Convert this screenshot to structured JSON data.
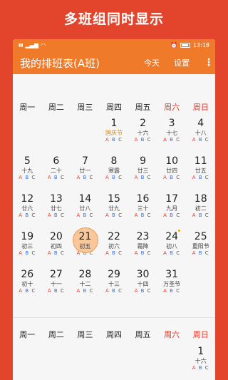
{
  "promo_title": "多班组同时显示",
  "status": {
    "time": "13:18"
  },
  "appbar": {
    "title": "我的排班表(A班)",
    "today": "今天",
    "settings": "设置",
    "more": "⋮"
  },
  "weekdays": [
    "周一",
    "周二",
    "周三",
    "周四",
    "周五",
    "周六",
    "周日"
  ],
  "month1": [
    {
      "num": "",
      "lunar": ""
    },
    {
      "num": "",
      "lunar": ""
    },
    {
      "num": "",
      "lunar": ""
    },
    {
      "num": "1",
      "lunar": "国庆节",
      "holiday": true
    },
    {
      "num": "2",
      "lunar": "十六"
    },
    {
      "num": "3",
      "lunar": "十七"
    },
    {
      "num": "4",
      "lunar": "十八"
    },
    {
      "num": "5",
      "lunar": "十九"
    },
    {
      "num": "6",
      "lunar": "二十"
    },
    {
      "num": "7",
      "lunar": "廿一"
    },
    {
      "num": "8",
      "lunar": "寒露"
    },
    {
      "num": "9",
      "lunar": "廿三"
    },
    {
      "num": "10",
      "lunar": "廿四"
    },
    {
      "num": "11",
      "lunar": "廿五"
    },
    {
      "num": "12",
      "lunar": "廿六"
    },
    {
      "num": "13",
      "lunar": "廿七"
    },
    {
      "num": "14",
      "lunar": "廿八"
    },
    {
      "num": "15",
      "lunar": "廿九"
    },
    {
      "num": "16",
      "lunar": "三十"
    },
    {
      "num": "17",
      "lunar": "九月"
    },
    {
      "num": "18",
      "lunar": "初二"
    },
    {
      "num": "19",
      "lunar": "初三"
    },
    {
      "num": "20",
      "lunar": "初四"
    },
    {
      "num": "21",
      "lunar": "初五",
      "today": true
    },
    {
      "num": "22",
      "lunar": "初六"
    },
    {
      "num": "23",
      "lunar": "霜降"
    },
    {
      "num": "24",
      "lunar": "初八",
      "dot": true
    },
    {
      "num": "25",
      "lunar": "重阳节"
    },
    {
      "num": "26",
      "lunar": "初十"
    },
    {
      "num": "27",
      "lunar": "十一"
    },
    {
      "num": "28",
      "lunar": "十二"
    },
    {
      "num": "29",
      "lunar": "十三"
    },
    {
      "num": "30",
      "lunar": "十四"
    },
    {
      "num": "31",
      "lunar": "万圣节"
    }
  ],
  "month2": [
    {
      "num": "",
      "lunar": ""
    },
    {
      "num": "",
      "lunar": ""
    },
    {
      "num": "",
      "lunar": ""
    },
    {
      "num": "",
      "lunar": ""
    },
    {
      "num": "",
      "lunar": ""
    },
    {
      "num": "",
      "lunar": ""
    },
    {
      "num": "1",
      "lunar": "十六"
    }
  ],
  "shift_labels": [
    "A",
    "B",
    "C"
  ]
}
